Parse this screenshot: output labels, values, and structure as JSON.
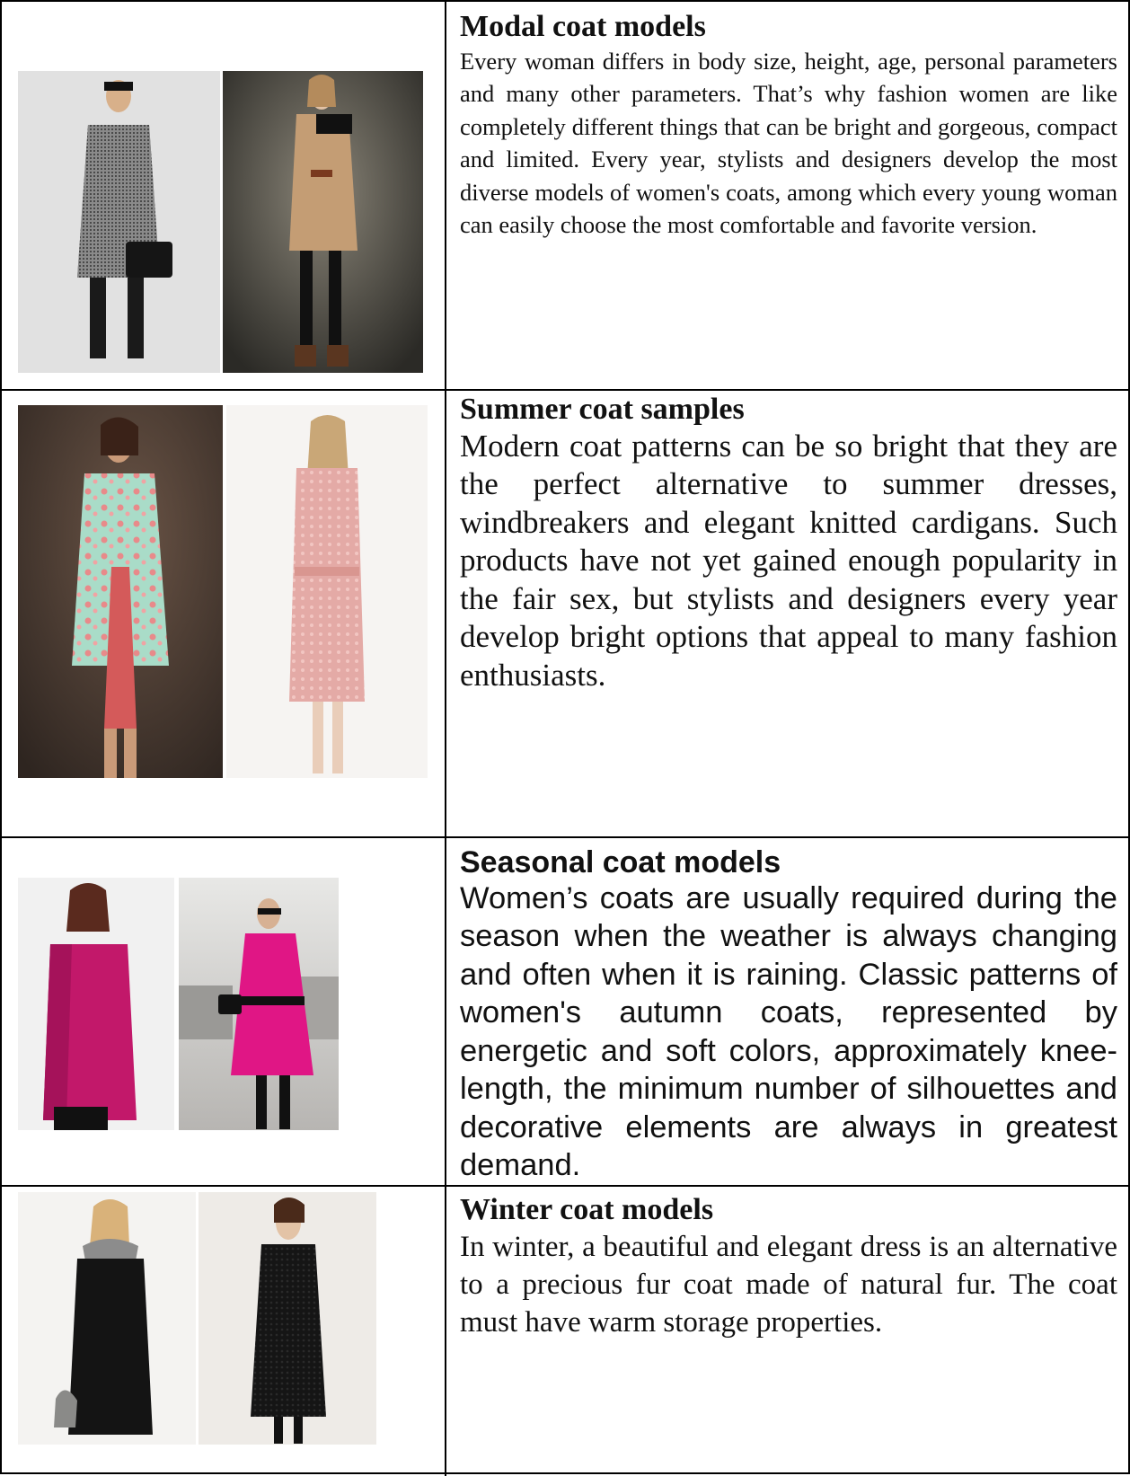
{
  "sections": [
    {
      "title": "Modal coat models",
      "text": "Every woman differs in body size, height, age, personal parameters and many other parameters. That’s why fashion women are like completely different things that can be bright and gorgeous, compact and limited. Every year, stylists and designers develop the most diverse models of women's coats, among which every young woman can easily choose the most comfortable and favorite version.",
      "photos": [
        "model-grey-tweed-coat-photo",
        "model-camel-coat-photo"
      ]
    },
    {
      "title": "Summer coat samples",
      "text": "Modern coat patterns can be so bright that they are the perfect alternative to summer dresses, windbreakers and elegant knitted cardigans. Such products have not yet gained enough popularity in the fair sex, but stylists and designers every year develop bright options that appeal to many fashion enthusiasts.",
      "photos": [
        "model-floral-mint-coat-photo",
        "model-pink-lace-trench-photo"
      ]
    },
    {
      "title": "Seasonal coat models",
      "text": "Women’s coats are usually required during the season when the weather is always changing and often when it is raining. Classic patterns of women's autumn coats, represented by energetic and soft colors, approximately knee-length, the minimum number of silhouettes and decorative elements are always in greatest demand.",
      "photos": [
        "model-magenta-coat-photo",
        "model-magenta-street-coat-photo"
      ]
    },
    {
      "title": "Winter coat models",
      "text": "In winter, a beautiful and elegant dress is an alternative to a precious fur coat made of natural fur. The coat must have warm storage properties.",
      "photos": [
        "model-black-fur-collar-coat-photo",
        "model-black-textured-coat-photo"
      ]
    }
  ]
}
